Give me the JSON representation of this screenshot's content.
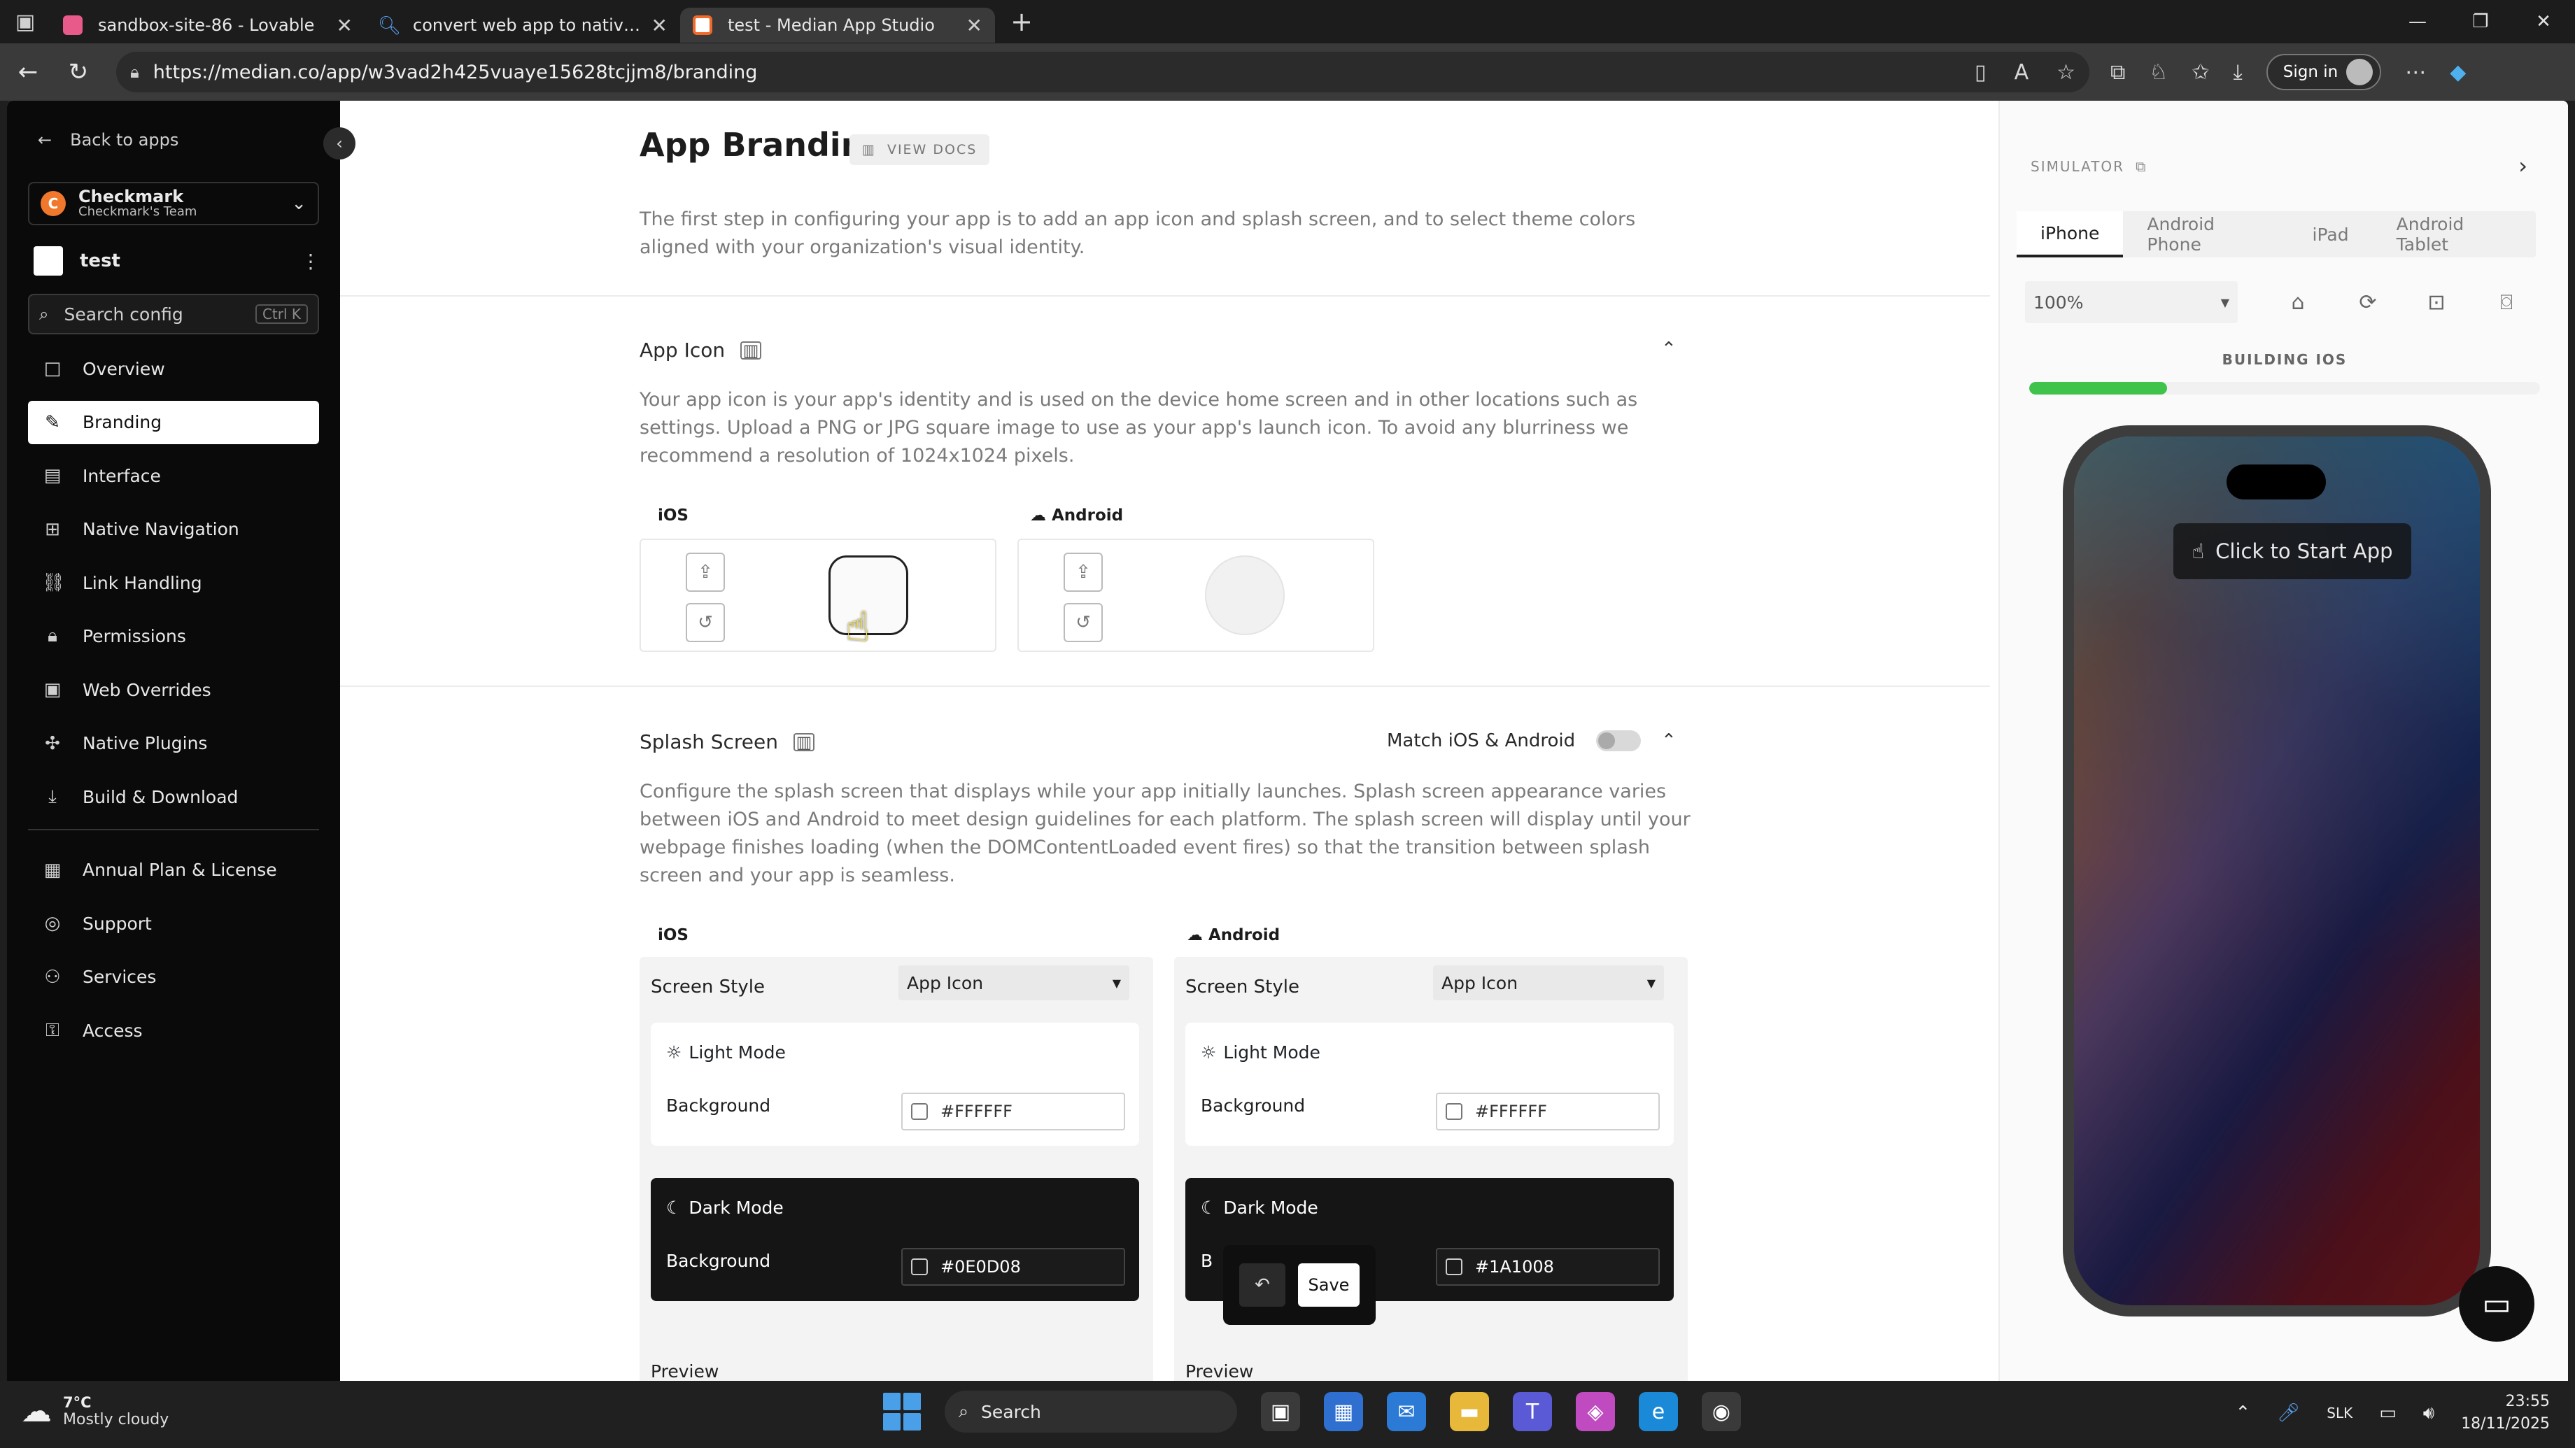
{
  "browser": {
    "tabs": [
      {
        "title": "sandbox-site-86 - Lovable",
        "color": "#e85a8a"
      },
      {
        "title": "convert web app to native app - Search",
        "color": "#2f7fe0"
      },
      {
        "title": "test - Median App Studio",
        "color": "#ffffff"
      }
    ],
    "url": "https://median.co/app/w3vad2h425vuaye15628tcjjm8/branding",
    "signin": "Sign in"
  },
  "sidebar": {
    "back": "Back to apps",
    "org_name": "Checkmark",
    "org_team": "Checkmark's Team",
    "org_initial": "C",
    "app_name": "test",
    "search_placeholder": "Search config",
    "search_kbd": "Ctrl K",
    "items": [
      {
        "label": "Overview",
        "icon": "square-icon"
      },
      {
        "label": "Branding",
        "icon": "brush-icon",
        "active": true
      },
      {
        "label": "Interface",
        "icon": "layout-icon"
      },
      {
        "label": "Native Navigation",
        "icon": "navigation-icon"
      },
      {
        "label": "Link Handling",
        "icon": "link-icon"
      },
      {
        "label": "Permissions",
        "icon": "lock-icon"
      },
      {
        "label": "Web Overrides",
        "icon": "code-icon"
      },
      {
        "label": "Native Plugins",
        "icon": "plugin-icon"
      },
      {
        "label": "Build & Download",
        "icon": "download-icon"
      }
    ],
    "items2": [
      {
        "label": "Annual Plan & License",
        "icon": "license-icon"
      },
      {
        "label": "Support",
        "icon": "support-icon"
      },
      {
        "label": "Services",
        "icon": "user-icon"
      },
      {
        "label": "Access",
        "icon": "access-icon"
      }
    ]
  },
  "main": {
    "title": "App Branding",
    "view_docs": "VIEW DOCS",
    "intro": "The first step in configuring your app is to add an app icon and splash screen, and to select theme colors aligned with your organization's visual identity.",
    "app_icon": {
      "title": "App Icon",
      "desc": "Your app icon is your app's identity and is used on the device home screen and in other locations such as settings. Upload a PNG or JPG square image to use as your app's launch icon. To avoid any blurriness we recommend a resolution of 1024x1024 pixels.",
      "ios_label": "iOS",
      "android_label": "Android"
    },
    "splash": {
      "title": "Splash Screen",
      "match_label": "Match iOS & Android",
      "desc": "Configure the splash screen that displays while your app initially launches. Splash screen appearance varies between iOS and Android to meet design guidelines for each platform. The splash screen will display until your webpage finishes loading (when the DOMContentLoaded event fires) so that the transition between splash screen and your app is seamless.",
      "ios": {
        "label": "iOS",
        "screen_style_label": "Screen Style",
        "screen_style_value": "App Icon",
        "light_mode": "Light Mode",
        "light_bg_label": "Background",
        "light_bg": "#FFFFFF",
        "dark_mode": "Dark Mode",
        "dark_bg_label": "Background",
        "dark_bg": "#0E0D08",
        "preview": "Preview"
      },
      "android": {
        "label": "Android",
        "screen_style_label": "Screen Style",
        "screen_style_value": "App Icon",
        "light_mode": "Light Mode",
        "light_bg_label": "Background",
        "light_bg": "#FFFFFF",
        "dark_mode": "Dark Mode",
        "dark_bg_label": "B",
        "dark_bg": "#1A1008",
        "preview": "Preview"
      }
    },
    "save": "Save"
  },
  "simulator": {
    "title": "SIMULATOR",
    "tabs": [
      "iPhone",
      "Android Phone",
      "iPad",
      "Android Tablet"
    ],
    "zoom": "100%",
    "status": "BUILDING IOS",
    "progress": 0.27,
    "start": "Click to Start App"
  },
  "taskbar": {
    "temp": "7°C",
    "weather": "Mostly cloudy",
    "search": "Search",
    "lang": "SLK",
    "time": "23:55",
    "date": "18/11/2025"
  }
}
